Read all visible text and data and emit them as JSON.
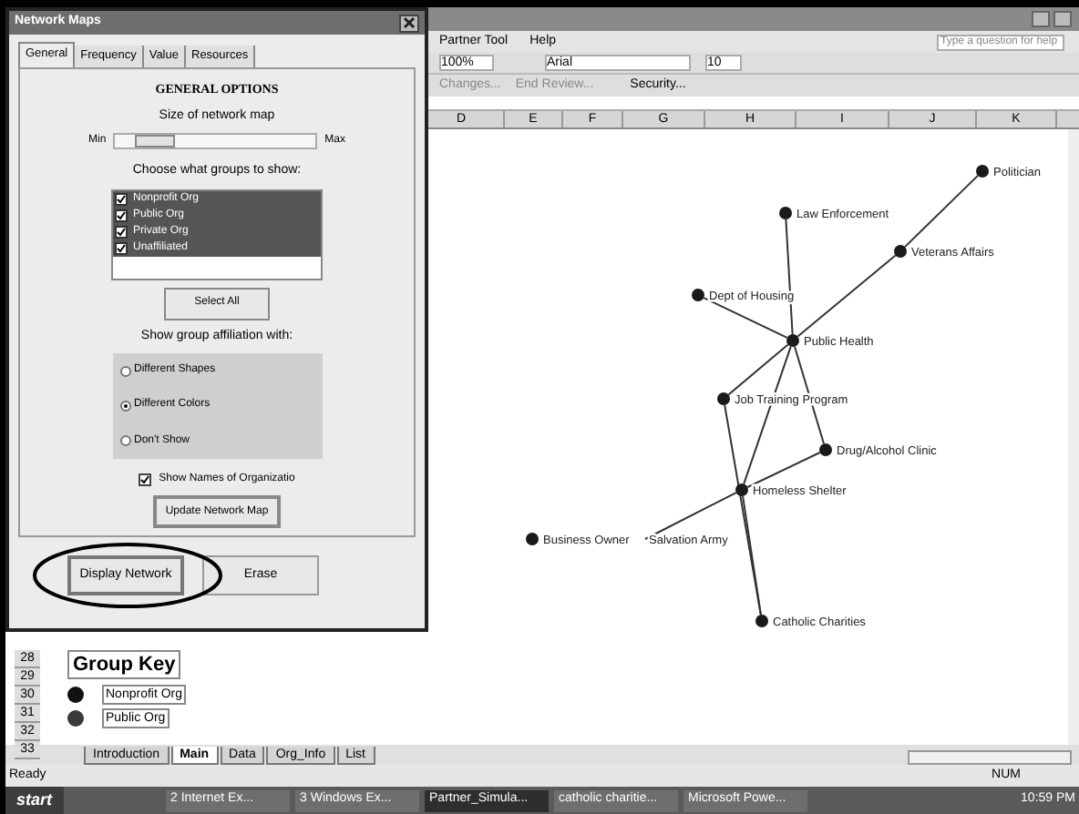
{
  "excel": {
    "menu": [
      "Partner Tool",
      "Help"
    ],
    "help_placeholder": "Type a question for help",
    "zoom": "100%",
    "font": "Arial",
    "font_size": "10",
    "review": [
      "Changes...",
      "End Review..."
    ],
    "security": "Security...",
    "columns": [
      "D",
      "E",
      "F",
      "G",
      "H",
      "I",
      "J",
      "K"
    ],
    "rows": [
      "28",
      "29",
      "30",
      "31",
      "32",
      "33"
    ]
  },
  "network_map": {
    "nodes": [
      {
        "name": "Politician"
      },
      {
        "name": "Law Enforcement"
      },
      {
        "name": "Veterans Affairs"
      },
      {
        "name": "Dept of Housing"
      },
      {
        "name": "Public Health"
      },
      {
        "name": "Job Training Program"
      },
      {
        "name": "Drug/Alcohol Clinic"
      },
      {
        "name": "Homeless Shelter"
      },
      {
        "name": "Business Owner"
      },
      {
        "name": "Salvation Army"
      },
      {
        "name": "Catholic Charities"
      }
    ]
  },
  "group_key": {
    "title": "Group Key",
    "groups": [
      {
        "name": "Nonprofit Org",
        "color": "#111111"
      },
      {
        "name": "Public Org",
        "color": "#3a3a3a"
      }
    ]
  },
  "sheet_tabs": [
    {
      "label": "Introduction",
      "selected": false
    },
    {
      "label": "Main",
      "selected": true
    },
    {
      "label": "Data",
      "selected": false
    },
    {
      "label": "Org_Info",
      "selected": false
    },
    {
      "label": "List",
      "selected": false
    }
  ],
  "status_bar": {
    "text": "Ready",
    "num": "NUM"
  },
  "dialog": {
    "title": "Network Maps",
    "tabs": [
      {
        "label": "General",
        "selected": true
      },
      {
        "label": "Frequency",
        "selected": false
      },
      {
        "label": "Value",
        "selected": false
      },
      {
        "label": "Resources",
        "selected": false
      }
    ],
    "heading": "GENERAL OPTIONS",
    "size_label": "Size of network map",
    "min": "Min",
    "max": "Max",
    "size_slider": {
      "level": 0.2
    },
    "groups_label": "Choose what groups to show:",
    "groups": [
      {
        "label": "Nonprofit Org",
        "checked": true,
        "selected": true
      },
      {
        "label": "Public Org",
        "checked": true,
        "selected": true
      },
      {
        "label": "Private Org",
        "checked": true,
        "selected": true
      },
      {
        "label": "Unaffiliated",
        "checked": true,
        "selected": true
      }
    ],
    "select_all": "Select All",
    "affiliation_label": "Show group affiliation with:",
    "affiliation": [
      {
        "label": "Different Shapes",
        "selected": false
      },
      {
        "label": "Different Colors",
        "selected": true
      },
      {
        "label": "Don't Show",
        "selected": false
      }
    ],
    "show_names": {
      "label": "Show Names of Organizatio",
      "checked": true
    },
    "update": "Update Network Map",
    "display": "Display Network",
    "erase": "Erase"
  },
  "taskbar": {
    "start": "start",
    "items": [
      {
        "label": "2 Internet Ex...",
        "selected": false
      },
      {
        "label": "3 Windows Ex...",
        "selected": false
      },
      {
        "label": "Partner_Simula...",
        "selected": true
      },
      {
        "label": "catholic charitie...",
        "selected": false
      },
      {
        "label": "Microsoft Powe...",
        "selected": false
      }
    ],
    "clock": "10:59 PM"
  }
}
